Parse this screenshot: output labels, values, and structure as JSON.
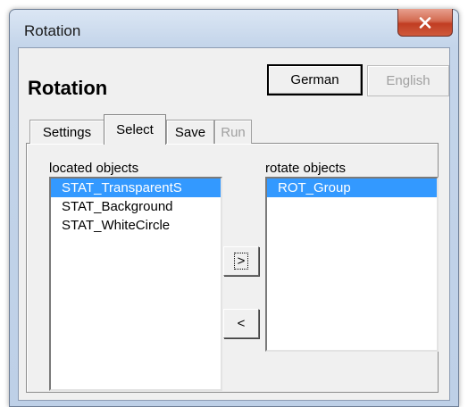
{
  "window": {
    "title": "Rotation",
    "close_icon": "close-icon"
  },
  "header": {
    "heading": "Rotation",
    "language_buttons": {
      "german": "German",
      "english": "English"
    }
  },
  "tabs": [
    {
      "label": "Settings",
      "active": false,
      "enabled": true
    },
    {
      "label": "Select",
      "active": true,
      "enabled": true
    },
    {
      "label": "Save",
      "active": false,
      "enabled": true
    },
    {
      "label": "Run",
      "active": false,
      "enabled": false
    }
  ],
  "select_panel": {
    "located_label": "located objects",
    "located_items": [
      {
        "label": "STAT_TransparentS",
        "selected": true
      },
      {
        "label": "STAT_Background",
        "selected": false
      },
      {
        "label": "STAT_WhiteCircle",
        "selected": false
      }
    ],
    "move_right_label": ">",
    "move_left_label": "<",
    "rotate_label": "rotate objects",
    "rotate_items": [
      {
        "label": "ROT_Group",
        "selected": true
      }
    ]
  },
  "colors": {
    "selection": "#3399ff",
    "close_button": "#c13d22"
  }
}
